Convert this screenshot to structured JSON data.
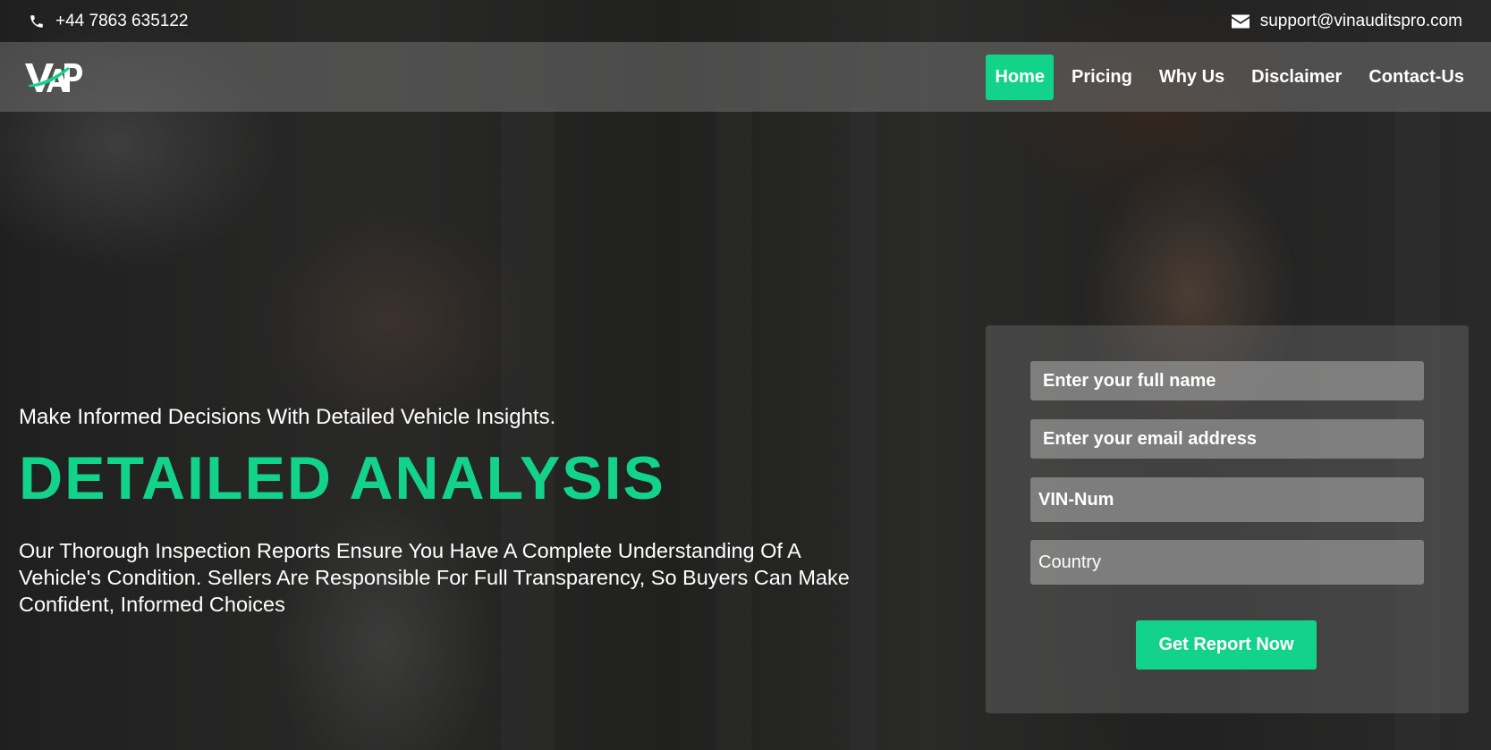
{
  "topbar": {
    "phone": "+44 7863 635122",
    "phone_icon": "phone-icon",
    "email": "support@vinauditspro.com",
    "email_icon": "envelope-icon"
  },
  "brand": {
    "logo_text": "VAP",
    "logo_accent_color": "#13d38a"
  },
  "nav": {
    "items": [
      {
        "label": "Home",
        "active": true
      },
      {
        "label": "Pricing"
      },
      {
        "label": "Why Us"
      },
      {
        "label": "Disclaimer"
      },
      {
        "label": "Contact-Us"
      }
    ]
  },
  "hero": {
    "tagline": "Make Informed Decisions With Detailed Vehicle Insights.",
    "headline": "DETAILED ANALYSIS",
    "description": "Our Thorough Inspection Reports Ensure You Have A Complete Understanding Of A Vehicle's Condition. Sellers Are Responsible For Full Transparency, So Buyers Can Make Confident, Informed Choices"
  },
  "form": {
    "name_placeholder": "Enter your full name",
    "email_placeholder": "Enter your email address",
    "vin_placeholder": "VIN-Num",
    "country_placeholder": "Country",
    "submit_label": "Get Report Now"
  },
  "colors": {
    "accent": "#13d38a",
    "text": "#ffffff"
  }
}
